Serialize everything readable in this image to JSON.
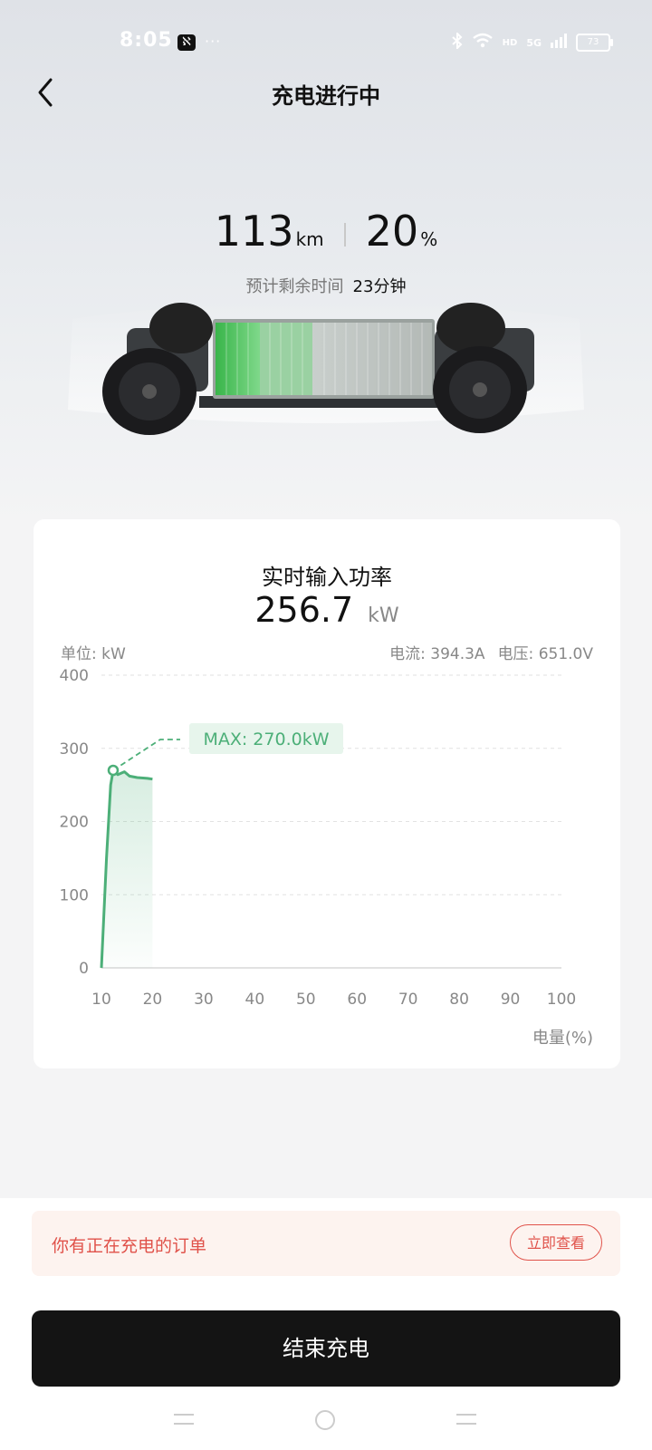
{
  "status_bar": {
    "time": "8:05",
    "app_icon": "ℵ",
    "dots": "···",
    "battery": "73",
    "network": "5G",
    "hd": "HD"
  },
  "header": {
    "title": "充电进行中",
    "back_icon": "chevron-left-icon"
  },
  "summary": {
    "range_value": "113",
    "range_unit": "km",
    "soc_value": "20",
    "soc_unit": "%",
    "eta_label": "预计剩余时间",
    "eta_value": "23分钟",
    "battery_fill_percent": 20
  },
  "power_card": {
    "title": "实时输入功率",
    "value": "256.7",
    "unit": "kW",
    "unit_label": "单位: kW",
    "current": "电流: 394.3A",
    "voltage": "电压: 651.0V",
    "max_label": "MAX: 270.0kW",
    "x_axis_label": "电量(%)"
  },
  "chart_data": {
    "type": "area",
    "xlabel": "电量(%)",
    "ylabel": "单位: kW",
    "xlim": [
      10,
      100
    ],
    "ylim": [
      0,
      400
    ],
    "x_ticks": [
      10,
      20,
      30,
      40,
      50,
      60,
      70,
      80,
      90,
      100
    ],
    "y_ticks": [
      0,
      100,
      200,
      300,
      400
    ],
    "grid": true,
    "series": [
      {
        "x": [
          10,
          11,
          11.8,
          12.3,
          13.2,
          14.5,
          15.5,
          17,
          19,
          20
        ],
        "y": [
          0,
          150,
          250,
          270,
          264,
          268,
          262,
          260,
          259,
          258
        ]
      }
    ],
    "max_point": {
      "x": 12.3,
      "y": 270.0
    },
    "color": "#4caf78"
  },
  "order_banner": {
    "text": "你有正在充电的订单",
    "button_label": "立即查看"
  },
  "stop_button": {
    "label": "结束充电"
  },
  "colors": {
    "accent_green": "#4caf78",
    "alert_red": "#e0524a",
    "stop_button_bg": "#141414"
  }
}
